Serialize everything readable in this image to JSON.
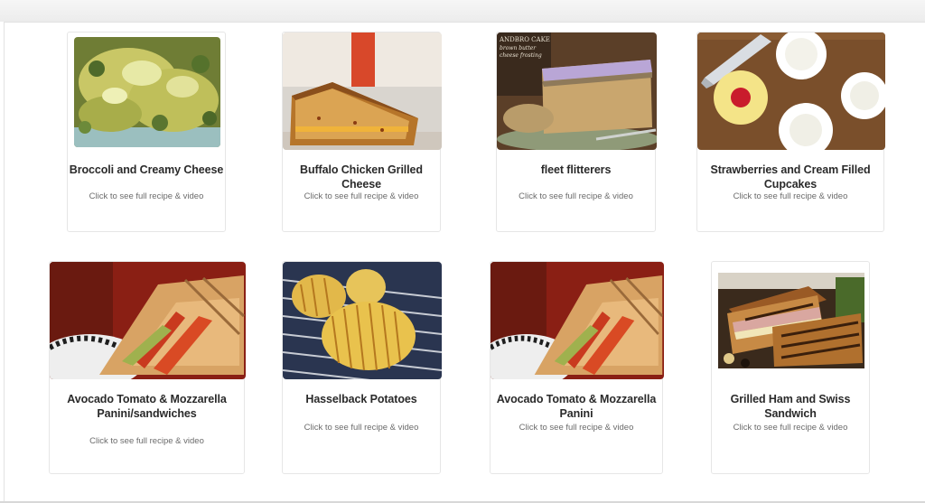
{
  "cards": [
    {
      "title": "Broccoli and Creamy Cheese",
      "cta": "Click to see full recipe & video",
      "image": "broccoli-cheese-casserole-photo"
    },
    {
      "title": "Buffalo Chicken Grilled Cheese",
      "cta": "Click to see full recipe & video",
      "image": "buffalo-chicken-grilled-cheese-photo"
    },
    {
      "title": "fleet flitterers",
      "cta": "Click to see full recipe & video",
      "image": "cake-slice-photo",
      "image_caption": "ANDBRO CAKE\nbrown butter\ncheese frosting"
    },
    {
      "title": "Strawberries and Cream Filled Cupcakes",
      "cta": "Click to see full recipe & video",
      "image": "filled-cupcakes-photo"
    },
    {
      "title": "Avocado Tomato & Mozzarella Panini/sandwiches",
      "cta": "Click to see full recipe & video",
      "image": "avocado-panini-photo"
    },
    {
      "title": "Hasselback Potatoes",
      "cta": "Click to see full recipe & video",
      "image": "hasselback-potatoes-photo"
    },
    {
      "title": "Avocado Tomato & Mozzarella Panini",
      "cta": "Click to see full recipe & video",
      "image": "avocado-panini-photo"
    },
    {
      "title": "Grilled Ham and Swiss Sandwich",
      "cta": "Click to see full recipe & video",
      "image": "grilled-ham-swiss-photo"
    }
  ]
}
